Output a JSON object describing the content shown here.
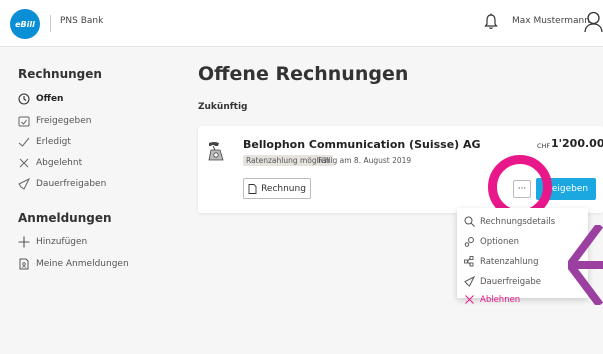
{
  "header": {
    "logo_text": "eBill",
    "bank_name": "PNS Bank",
    "user_name": "Max Mustermann"
  },
  "sidebar": {
    "section1_title": "Rechnungen",
    "items1": [
      {
        "label": "Offen",
        "icon": "clock-icon"
      },
      {
        "label": "Freigegeben",
        "icon": "calendar-check-icon"
      },
      {
        "label": "Erledigt",
        "icon": "check-icon"
      },
      {
        "label": "Abgelehnt",
        "icon": "x-icon"
      },
      {
        "label": "Dauerfreigaben",
        "icon": "rocket-icon"
      }
    ],
    "section2_title": "Anmeldungen",
    "items2": [
      {
        "label": "Hinzufügen",
        "icon": "plus-icon"
      },
      {
        "label": "Meine Anmeldungen",
        "icon": "document-user-icon"
      }
    ]
  },
  "main": {
    "title": "Offene Rechnungen",
    "subtitle": "Zukünftig"
  },
  "invoice": {
    "company": "Bellophon Communication (Suisse) AG",
    "badge": "Ratenzahlung möglich",
    "due": "Fällig am 8. August 2019",
    "currency": "CHF",
    "amount": "1'200.00",
    "rechnung_label": "Rechnung",
    "more_label": "···",
    "freigeben_label": "Freigeben"
  },
  "menu": {
    "items": [
      {
        "label": "Rechnungsdetails",
        "icon": "magnifier-icon"
      },
      {
        "label": "Optionen",
        "icon": "gears-icon"
      },
      {
        "label": "Ratenzahlung",
        "icon": "installment-icon"
      },
      {
        "label": "Dauerfreigabe",
        "icon": "rocket-icon"
      },
      {
        "label": "Ablehnen",
        "icon": "x-icon"
      }
    ]
  },
  "colors": {
    "accent": "#1ba8e0",
    "highlight_ring": "#e8178a",
    "arrow": "#9b3fa0",
    "danger": "#e8178a"
  }
}
